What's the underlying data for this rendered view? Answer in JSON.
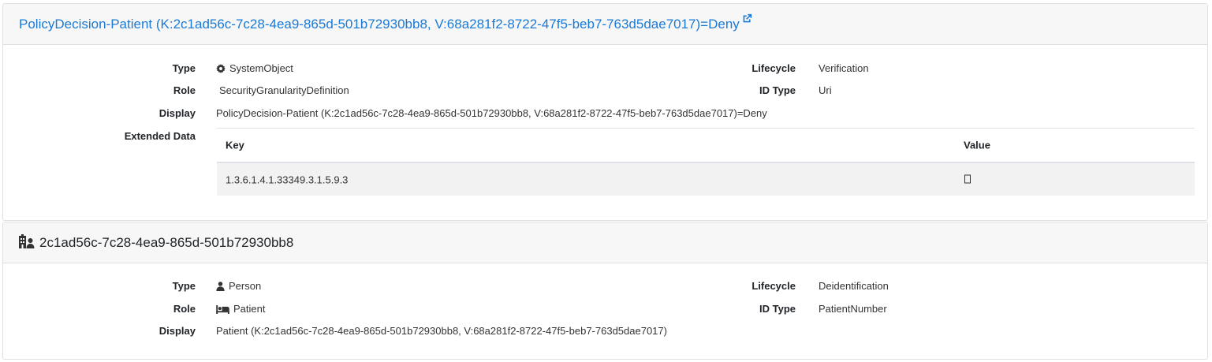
{
  "policy_card": {
    "title": "PolicyDecision-Patient (K:2c1ad56c-7c28-4ea9-865d-501b72930bb8, V:68a281f2-8722-47f5-beb7-763d5dae7017)=Deny",
    "title_icon": "external-link-icon",
    "fields": {
      "type_label": "Type",
      "type_value": "SystemObject",
      "type_icon": "gear-icon",
      "role_label": "Role",
      "role_value": "SecurityGranularityDefinition",
      "display_label": "Display",
      "display_value": "PolicyDecision-Patient (K:2c1ad56c-7c28-4ea9-865d-501b72930bb8, V:68a281f2-8722-47f5-beb7-763d5dae7017)=Deny",
      "extended_label": "Extended Data",
      "lifecycle_label": "Lifecycle",
      "lifecycle_value": "Verification",
      "idtype_label": "ID Type",
      "idtype_value": "Uri"
    },
    "extended_table": {
      "columns": [
        "Key",
        "Value"
      ],
      "rows": [
        {
          "key": "1.3.6.1.4.1.33349.3.1.5.9.3",
          "value": ""
        }
      ]
    }
  },
  "patient_card": {
    "title": "2c1ad56c-7c28-4ea9-865d-501b72930bb8",
    "title_icon": "hospital-user-icon",
    "fields": {
      "type_label": "Type",
      "type_value": "Person",
      "type_icon": "user-icon",
      "role_label": "Role",
      "role_value": "Patient",
      "role_icon": "bed-icon",
      "display_label": "Display",
      "display_value": "Patient (K:2c1ad56c-7c28-4ea9-865d-501b72930bb8, V:68a281f2-8722-47f5-beb7-763d5dae7017)",
      "lifecycle_label": "Lifecycle",
      "lifecycle_value": "Deidentification",
      "idtype_label": "ID Type",
      "idtype_value": "PatientNumber"
    }
  },
  "colors": {
    "link": "#1a7ad6",
    "header_bg": "#f7f7f7",
    "row_stripe": "#f2f2f2",
    "border": "#dfdfdf"
  }
}
